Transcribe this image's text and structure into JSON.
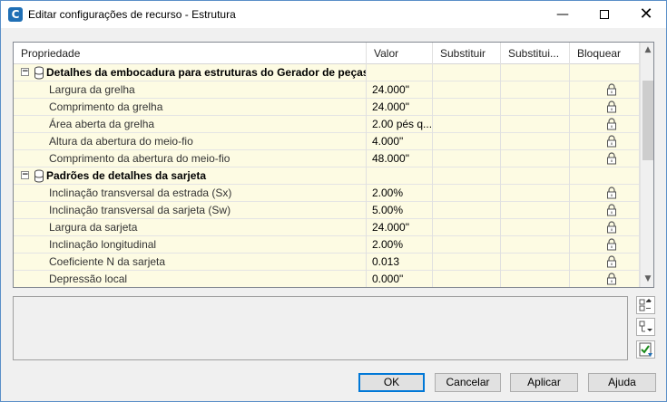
{
  "window": {
    "title": "Editar configurações de recurso - Estrutura",
    "app_icon_letter": "C",
    "minimize": "—",
    "close": "✕"
  },
  "grid": {
    "columns": [
      "Propriedade",
      "Valor",
      "Substituir",
      "Substitui...",
      "Bloquear"
    ],
    "rows": [
      {
        "type": "section",
        "expander": "−",
        "label": "Detalhes da embocadura para estruturas do Gerador de peças"
      },
      {
        "type": "item",
        "label": "Largura da grelha",
        "value": "24.000\"",
        "locked": true
      },
      {
        "type": "item",
        "label": "Comprimento da grelha",
        "value": "24.000\"",
        "locked": true
      },
      {
        "type": "item",
        "label": "Área aberta da grelha",
        "value": "2.00 pés q...",
        "locked": true
      },
      {
        "type": "item",
        "label": "Altura da abertura do meio-fio",
        "value": "4.000\"",
        "locked": true
      },
      {
        "type": "item",
        "label": "Comprimento da abertura do meio-fio",
        "value": "48.000\"",
        "locked": true
      },
      {
        "type": "section",
        "expander": "−",
        "label": "Padrões de detalhes da sarjeta"
      },
      {
        "type": "item",
        "label": "Inclinação transversal da estrada (Sx)",
        "value": "2.00%",
        "locked": true
      },
      {
        "type": "item",
        "label": "Inclinação transversal da sarjeta (Sw)",
        "value": "5.00%",
        "locked": true
      },
      {
        "type": "item",
        "label": "Largura da sarjeta",
        "value": "24.000\"",
        "locked": true
      },
      {
        "type": "item",
        "label": "Inclinação longitudinal",
        "value": "2.00%",
        "locked": true
      },
      {
        "type": "item",
        "label": "Coeficiente N da sarjeta",
        "value": "0.013",
        "locked": true
      },
      {
        "type": "item",
        "label": "Depressão local",
        "value": "0.000\"",
        "locked": true
      }
    ],
    "scroll_up": "▲",
    "scroll_down": "▼"
  },
  "buttons": {
    "ok": "OK",
    "cancel": "Cancelar",
    "apply": "Aplicar",
    "help": "Ajuda"
  },
  "colors": {
    "row_background": "#fdfbe3",
    "ok_border": "#0078d7"
  }
}
